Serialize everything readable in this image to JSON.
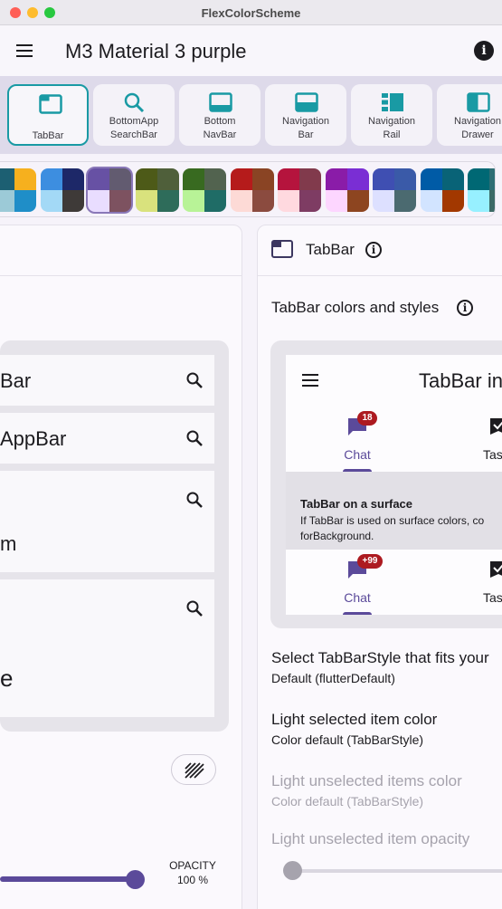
{
  "window": {
    "title": "FlexColorScheme"
  },
  "appbar": {
    "title": "M3  Material 3 purple",
    "info_icon": "i"
  },
  "nav_buttons": [
    {
      "label_1": "TabBar",
      "label_2": "",
      "icon": "tabbar-icon"
    },
    {
      "label_1": "BottomApp",
      "label_2": "SearchBar",
      "icon": "search-icon"
    },
    {
      "label_1": "Bottom",
      "label_2": "NavBar",
      "icon": "bottom-navbar-icon"
    },
    {
      "label_1": "Navigation",
      "label_2": "Bar",
      "icon": "navigation-bar-icon"
    },
    {
      "label_1": "Navigation",
      "label_2": "Rail",
      "icon": "navigation-rail-icon"
    },
    {
      "label_1": "Navigation",
      "label_2": "Drawer",
      "icon": "navigation-drawer-icon"
    }
  ],
  "swatches": [
    [
      "#1c5f72",
      "#f6b01e",
      "#9ccad7",
      "#1f8ec8"
    ],
    [
      "#3d8ee0",
      "#1d2868",
      "#a3d9f6",
      "#3e3a38"
    ],
    [
      "#6751a4",
      "#625b70",
      "#e9ddff",
      "#7d5260"
    ],
    [
      "#4d5a18",
      "#4f5f3a",
      "#d9e27d",
      "#2e6c5a"
    ],
    [
      "#386a20",
      "#52634f",
      "#b8f397",
      "#1f6c66"
    ],
    [
      "#b51b1b",
      "#8a4424",
      "#fddad6",
      "#8b4b3f"
    ],
    [
      "#b5143d",
      "#813a4c",
      "#ffd9df",
      "#7e3c63"
    ],
    [
      "#8a1ca8",
      "#7a2ed4",
      "#fdd6ff",
      "#8d4520"
    ],
    [
      "#3f4fb2",
      "#3a5aa8",
      "#dde0ff",
      "#4b6a70"
    ],
    [
      "#005ba6",
      "#096377",
      "#d2e4ff",
      "#a23800"
    ],
    [
      "#006874",
      "#2e6e74",
      "#97f0ff",
      "#3c6a66"
    ]
  ],
  "left_panel": {
    "search_bars": [
      "Bar",
      "AppBar",
      "m",
      "e"
    ],
    "opacity_label": "OPACITY",
    "opacity_value": "100 %",
    "opacity": 1.0
  },
  "right_panel": {
    "title": "TabBar",
    "section_title": "TabBar colors and styles",
    "preview": {
      "title": "TabBar in",
      "tab_chat": "Chat",
      "tab_tasks": "Tas",
      "badge_1": "18",
      "badge_2": "+99",
      "surface_heading": "TabBar on a surface",
      "surface_body_1": "If TabBar is used on surface colors, co",
      "surface_body_2": "forBackground."
    },
    "settings": [
      {
        "title": "Select TabBarStyle that fits your",
        "value": "Default (flutterDefault)",
        "disabled": false
      },
      {
        "title": "Light selected item color",
        "value": "Color default (TabBarStyle)",
        "disabled": false
      },
      {
        "title": "Light unselected items color",
        "value": "Color default (TabBarStyle)",
        "disabled": true
      },
      {
        "title": "Light unselected item opacity",
        "value": "",
        "disabled": true
      }
    ],
    "unselected_opacity_slider": 0.0
  },
  "colors": {
    "accent": "#199aa4",
    "primary": "#5b4a9a",
    "badge": "#ad1a20"
  }
}
